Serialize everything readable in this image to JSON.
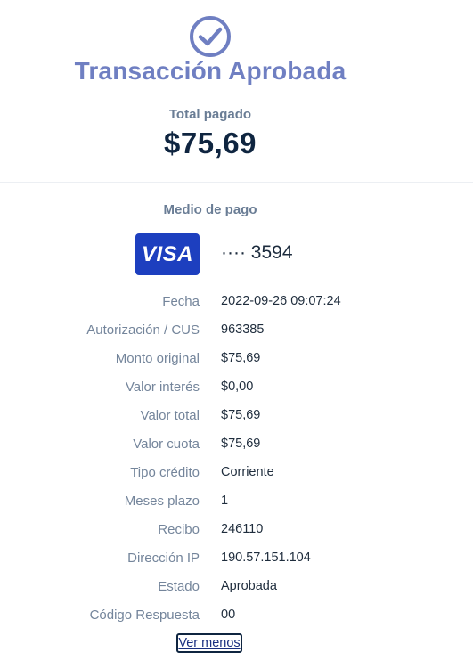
{
  "header": {
    "check_icon": "check-circle-icon",
    "title": "Transacción Aprobada",
    "total_label": "Total pagado",
    "total_amount": "$75,69"
  },
  "payment": {
    "method_label": "Medio de pago",
    "card_brand": "VISA",
    "card_number": "···· 3594"
  },
  "details": [
    {
      "label": "Fecha",
      "value": "2022-09-26 09:07:24"
    },
    {
      "label": "Autorización / CUS",
      "value": "963385"
    },
    {
      "label": "Monto original",
      "value": "$75,69"
    },
    {
      "label": "Valor interés",
      "value": "$0,00"
    },
    {
      "label": "Valor total",
      "value": "$75,69"
    },
    {
      "label": "Valor cuota",
      "value": "$75,69"
    },
    {
      "label": "Tipo crédito",
      "value": "Corriente"
    },
    {
      "label": "Meses plazo",
      "value": "1"
    },
    {
      "label": "Recibo",
      "value": "246110"
    },
    {
      "label": "Dirección IP",
      "value": "190.57.151.104"
    },
    {
      "label": "Estado",
      "value": "Aprobada"
    },
    {
      "label": "Código Respuesta",
      "value": "00"
    }
  ],
  "toggle": {
    "label": "Ver menos"
  },
  "colors": {
    "accent": "#6f7fc2",
    "visa_bg": "#1d3fbf",
    "amount": "#0f2540",
    "label": "#74859b"
  }
}
